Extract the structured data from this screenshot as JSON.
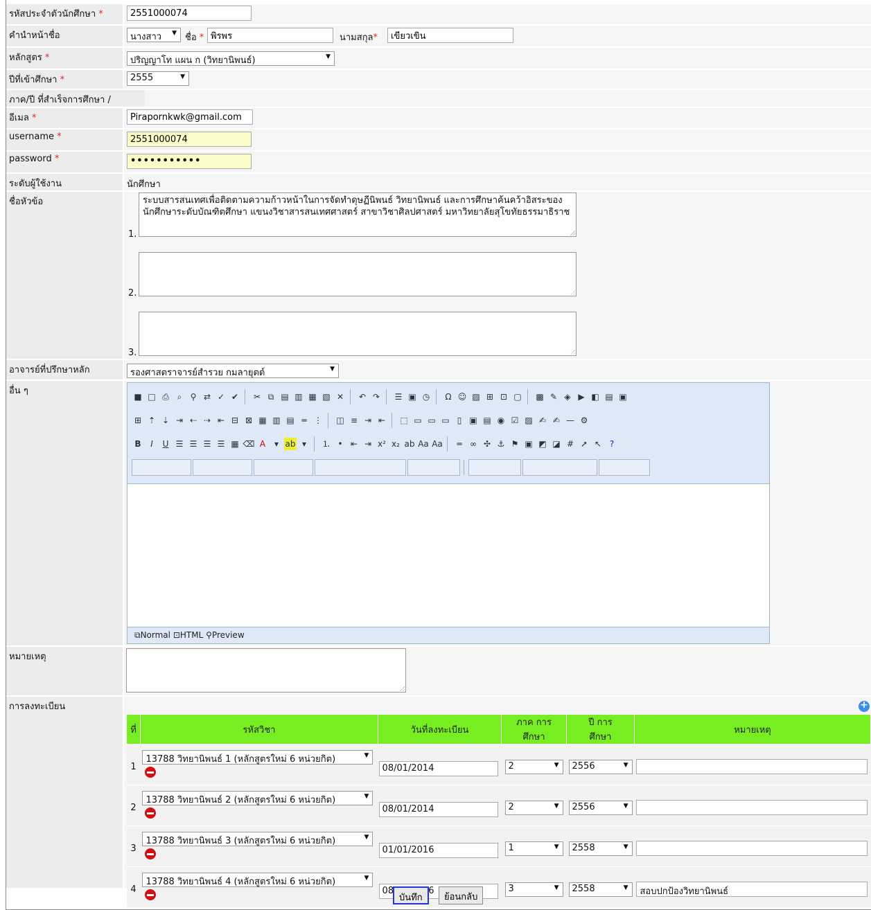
{
  "fields": {
    "student_id": {
      "label": "รหัสประจำตัวนักศึกษา",
      "value": "2551000074"
    },
    "name": {
      "label": "คำนำหน้าชื่อ",
      "prefix": "นางสาว",
      "first_label": "ชื่อ",
      "first": "พิรพร",
      "last_label": "นามสกุล",
      "last": "เขียวเขิน"
    },
    "program": {
      "label": "หลักสูตร",
      "value": "ปริญญาโท แผน ก (วิทยานิพนธ์)"
    },
    "entry_year": {
      "label": "ปีที่เข้าศึกษา",
      "value": "2555"
    },
    "graduated": {
      "label": "ภาค/ปี ที่สำเร็จการศึกษา",
      "value": "/"
    },
    "email": {
      "label": "อีเมล",
      "value": "Pirapornkwk@gmail.com"
    },
    "username": {
      "label": "username",
      "value": "2551000074"
    },
    "password": {
      "label": "password",
      "value": "•••••••••••"
    },
    "user_level": {
      "label": "ระดับผู้ใช้งาน",
      "value": "นักศึกษา"
    },
    "topic": {
      "label": "ชื่อหัวข้อ",
      "items": [
        {
          "num": "1.",
          "text": "ระบบสารสนเทศเพื่อติดตามความก้าวหน้าในการจัดทำดุษฏีนิพนธ์ วิทยานิพนธ์ และการศึกษาค้นคว้าอิสระของนักศึกษาระดับบัณฑิตศึกษา แขนงวิชาสารสนเทศศาสตร์ สาขาวิชาศิลปศาสตร์ มหาวิทยาลัยสุโขทัยธรรมาธิราช"
        },
        {
          "num": "2.",
          "text": ""
        },
        {
          "num": "3.",
          "text": ""
        }
      ]
    },
    "advisor": {
      "label": "อาจารย์ที่ปรึกษาหลัก",
      "value": "รองศาสตราจารย์สำรวย กมลายุตต์"
    },
    "other": {
      "label": "อื่น ๆ"
    },
    "note": {
      "label": "หมายเหตุ",
      "value": ""
    },
    "registration": {
      "label": "การลงทะเบียน"
    }
  },
  "editor": {
    "modes": {
      "normal": "Normal",
      "html": "HTML",
      "preview": "Preview"
    }
  },
  "reg_table": {
    "headers": {
      "no": "ที่",
      "course": "รหัสวิชา",
      "date": "วันที่ลงทะเบียน",
      "term": "ภาค การศึกษา",
      "year": "ปี การศึกษา",
      "note": "หมายเหตุ"
    },
    "rows": [
      {
        "no": "1",
        "course": "13788 วิทยานิพนธ์ 1 (หลักสูตรใหม่ 6 หน่วยกิต)",
        "date": "08/01/2014",
        "term": "2",
        "year": "2556",
        "note": ""
      },
      {
        "no": "2",
        "course": "13788 วิทยานิพนธ์ 2 (หลักสูตรใหม่ 6 หน่วยกิต)",
        "date": "08/01/2014",
        "term": "2",
        "year": "2556",
        "note": ""
      },
      {
        "no": "3",
        "course": "13788 วิทยานิพนธ์ 3 (หลักสูตรใหม่ 6 หน่วยกิต)",
        "date": "01/01/2016",
        "term": "1",
        "year": "2558",
        "note": ""
      },
      {
        "no": "4",
        "course": "13788 วิทยานิพนธ์ 4 (หลักสูตรใหม่ 6 หน่วยกิต)",
        "date": "08/31/2016",
        "term": "3",
        "year": "2558",
        "note": "สอบปกป้องวิทยานิพนธ์"
      }
    ]
  },
  "buttons": {
    "save": "บันทึก",
    "back": "ย้อนกลับ"
  },
  "colors": {
    "header_green": "#77ee22",
    "required": "#ee2222",
    "focus": "#2233dd"
  }
}
